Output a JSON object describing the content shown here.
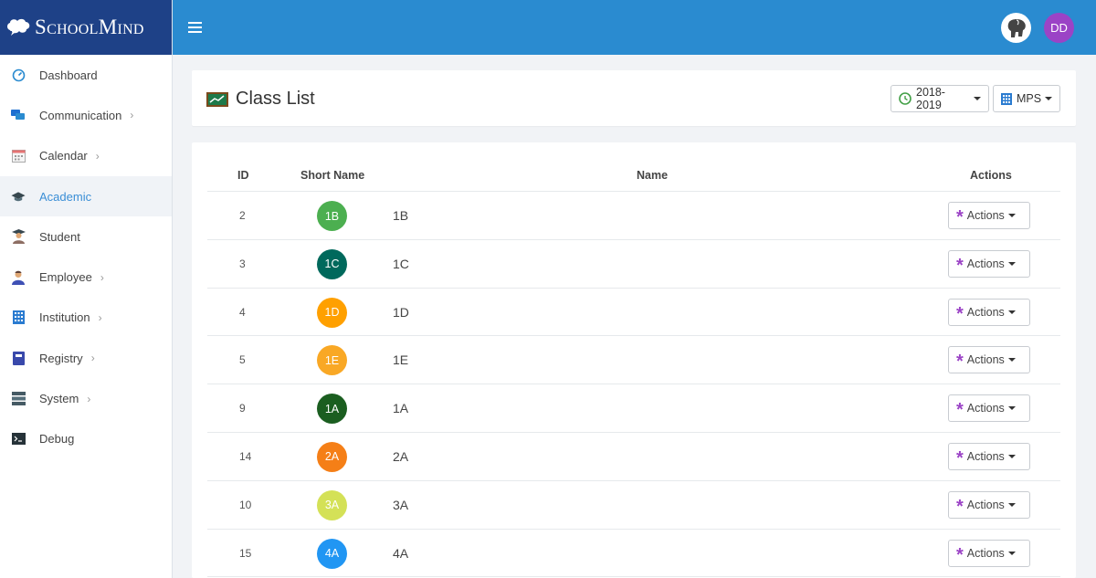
{
  "brand": {
    "name": "SchoolMind"
  },
  "sidebar": {
    "items": [
      {
        "label": "Dashboard",
        "icon": "dashboard-icon",
        "chevron": false,
        "active": false
      },
      {
        "label": "Communication",
        "icon": "chat-icon",
        "chevron": true,
        "active": false
      },
      {
        "label": "Calendar",
        "icon": "calendar-icon",
        "chevron": true,
        "active": false
      },
      {
        "label": "Academic",
        "icon": "graduation-cap-icon",
        "chevron": false,
        "active": true
      },
      {
        "label": "Student",
        "icon": "student-icon",
        "chevron": false,
        "active": false
      },
      {
        "label": "Employee",
        "icon": "employee-icon",
        "chevron": true,
        "active": false
      },
      {
        "label": "Institution",
        "icon": "building-icon",
        "chevron": true,
        "active": false
      },
      {
        "label": "Registry",
        "icon": "book-icon",
        "chevron": true,
        "active": false
      },
      {
        "label": "System",
        "icon": "server-icon",
        "chevron": true,
        "active": false
      },
      {
        "label": "Debug",
        "icon": "terminal-icon",
        "chevron": false,
        "active": false
      }
    ]
  },
  "header": {
    "user_initials": "DD"
  },
  "page": {
    "title": "Class List",
    "year_label": "2018-2019",
    "school_label": "MPS"
  },
  "table": {
    "headers": {
      "id": "ID",
      "short_name": "Short Name",
      "name": "Name",
      "actions": "Actions"
    },
    "action_label": "Actions",
    "rows": [
      {
        "id": "2",
        "short": "1B",
        "name": "1B",
        "color": "#4caf50"
      },
      {
        "id": "3",
        "short": "1C",
        "name": "1C",
        "color": "#00695c"
      },
      {
        "id": "4",
        "short": "1D",
        "name": "1D",
        "color": "#ffa000"
      },
      {
        "id": "5",
        "short": "1E",
        "name": "1E",
        "color": "#f9a825"
      },
      {
        "id": "9",
        "short": "1A",
        "name": "1A",
        "color": "#1b5e20"
      },
      {
        "id": "14",
        "short": "2A",
        "name": "2A",
        "color": "#f57f17"
      },
      {
        "id": "10",
        "short": "3A",
        "name": "3A",
        "color": "#d4e157"
      },
      {
        "id": "15",
        "short": "4A",
        "name": "4A",
        "color": "#2196f3"
      }
    ]
  },
  "colors": {
    "accent": "#2a8bd0",
    "brand_bg": "#1e4187",
    "action_icon": "#9b43c6"
  }
}
